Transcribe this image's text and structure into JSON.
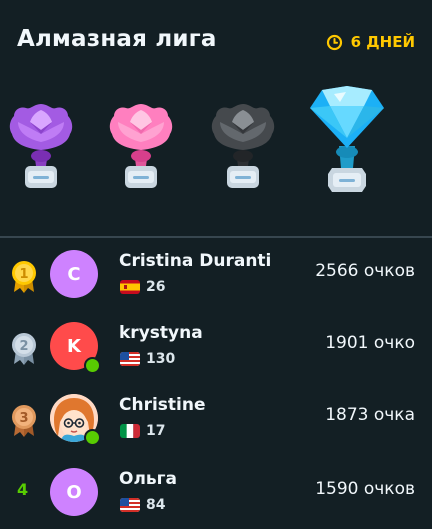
{
  "header": {
    "title": "Алмазная лига",
    "timer_label": "6 ДНЕЙ",
    "trophies": [
      {
        "name": "amethyst",
        "color": "#c07ff2",
        "locked": false
      },
      {
        "name": "pearl",
        "color": "#ff8fc6",
        "locked": false
      },
      {
        "name": "obsidian",
        "color": "#5f6468",
        "locked": false
      },
      {
        "name": "diamond",
        "color": "#38d4f7",
        "locked": false,
        "current": true
      }
    ]
  },
  "leaderboard": [
    {
      "rank": "1",
      "medal": "gold",
      "initial": "C",
      "avatar_color": "#ce82ff",
      "name": "Cristina Duranti",
      "flag": "es",
      "streak": "26",
      "points": "2566 очков",
      "online": false
    },
    {
      "rank": "2",
      "medal": "silver",
      "initial": "K",
      "avatar_color": "#ff4b4b",
      "name": "krystyna",
      "flag": "us",
      "streak": "130",
      "points": "1901 очко",
      "online": true
    },
    {
      "rank": "3",
      "medal": "bronze",
      "initial": "",
      "avatar_color": "#ff9aa8",
      "name": "Christine",
      "flag": "it",
      "streak": "17",
      "points": "1873 очка",
      "online": true
    },
    {
      "rank": "4",
      "medal": "",
      "initial": "О",
      "avatar_color": "#ce82ff",
      "name": "Ольга",
      "flag": "us",
      "streak": "84",
      "points": "1590 очков",
      "online": false
    }
  ]
}
